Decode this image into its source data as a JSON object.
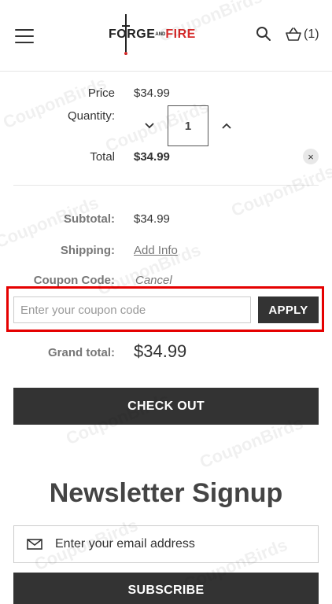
{
  "header": {
    "logo": {
      "part1": "FORGE",
      "part2": "AND",
      "part3": "FIRE"
    },
    "cart_count": "(1)"
  },
  "item": {
    "price_label": "Price",
    "price_value": "$34.99",
    "quantity_label": "Quantity:",
    "quantity_value": "1",
    "total_label": "Total",
    "total_value": "$34.99",
    "remove_label": "×"
  },
  "summary": {
    "subtotal_label": "Subtotal:",
    "subtotal_value": "$34.99",
    "shipping_label": "Shipping:",
    "shipping_link": "Add Info",
    "coupon_label": "Coupon Code:",
    "coupon_cancel": "Cancel",
    "coupon_placeholder": "Enter your coupon code",
    "apply_label": "APPLY",
    "grand_label": "Grand total:",
    "grand_value": "$34.99"
  },
  "checkout_label": "CHECK OUT",
  "newsletter": {
    "title": "Newsletter Signup",
    "email_placeholder": "Enter your email address",
    "subscribe_label": "SUBSCRIBE"
  },
  "watermark": "CouponBirds",
  "colors": {
    "accent": "#d62c2c",
    "highlight": "#e50000",
    "button": "#333333"
  }
}
